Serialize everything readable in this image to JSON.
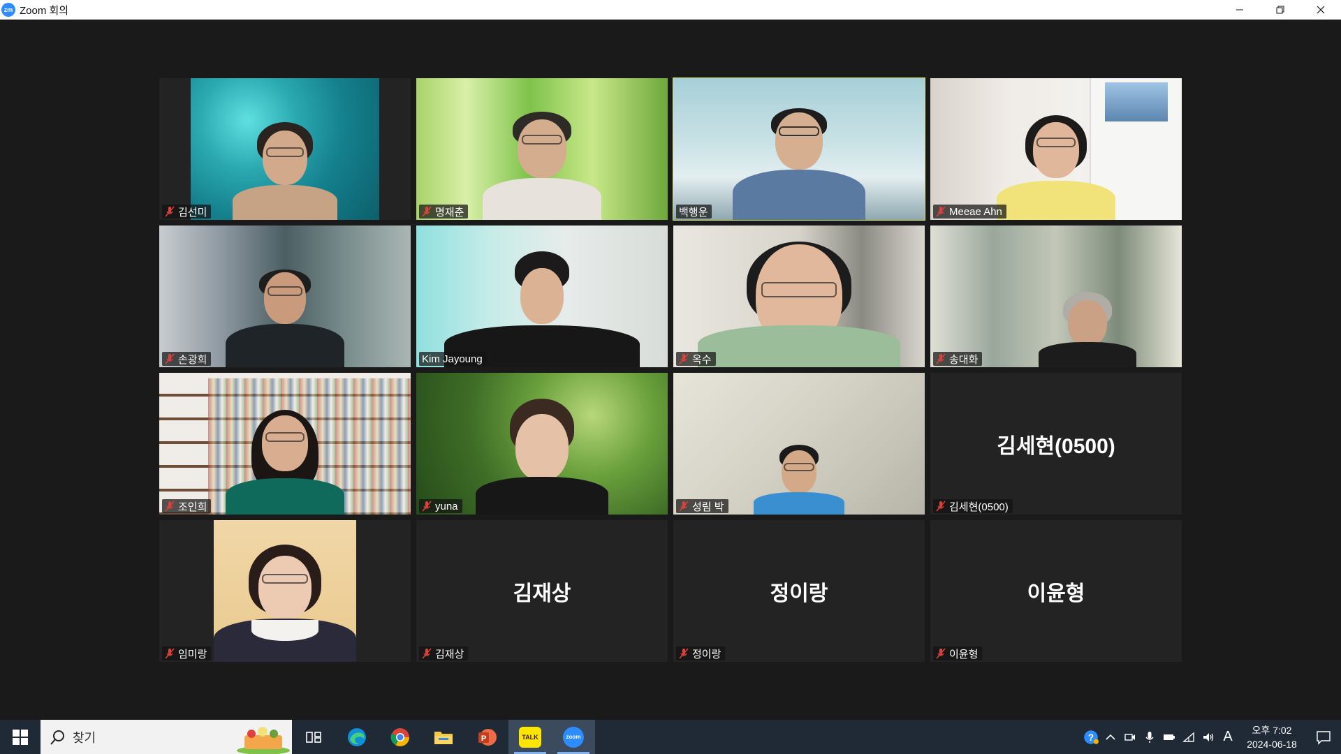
{
  "window": {
    "title": "Zoom 회의",
    "logo_text": "zm"
  },
  "colors": {
    "active_speaker_border": "#d6e06a",
    "muted_mic": "#e0413a",
    "background": "#1a1a1a"
  },
  "participants": [
    {
      "name": "김선미",
      "muted": true,
      "video": "ocean"
    },
    {
      "name": "명재춘",
      "muted": true,
      "video": "grass"
    },
    {
      "name": "백행운",
      "muted": false,
      "video": "mountain",
      "active_speaker": true
    },
    {
      "name": "Meeae Ahn",
      "muted": true,
      "video": "bedroom"
    },
    {
      "name": "손광희",
      "muted": true,
      "video": "office"
    },
    {
      "name": "Kim Jayoung",
      "muted": false,
      "video": "studio"
    },
    {
      "name": "옥수",
      "muted": true,
      "video": "room"
    },
    {
      "name": "송대화",
      "muted": true,
      "video": "library"
    },
    {
      "name": "조인희",
      "muted": true,
      "video": "bookshelf"
    },
    {
      "name": "yuna",
      "muted": true,
      "video": "forest"
    },
    {
      "name": "성림 박",
      "muted": true,
      "video": "wall"
    },
    {
      "name": "김세현(0500)",
      "muted": true,
      "video": "off",
      "display_name": "김세현(0500)"
    },
    {
      "name": "임미랑",
      "muted": true,
      "video": "portrait"
    },
    {
      "name": "김재상",
      "muted": true,
      "video": "off",
      "display_name": "김재상"
    },
    {
      "name": "정이랑",
      "muted": true,
      "video": "off",
      "display_name": "정이랑"
    },
    {
      "name": "이윤형",
      "muted": true,
      "video": "off",
      "display_name": "이윤형"
    }
  ],
  "taskbar": {
    "search_placeholder": "찾기",
    "pinned": [
      "task-view",
      "edge",
      "chrome",
      "file-explorer",
      "powerpoint",
      "kakaotalk",
      "zoom"
    ],
    "kakao_label": "TALK",
    "zoom_label": "zoom",
    "ime_indicator": "A",
    "clock_time": "오후 7:02",
    "clock_date": "2024-06-18"
  }
}
